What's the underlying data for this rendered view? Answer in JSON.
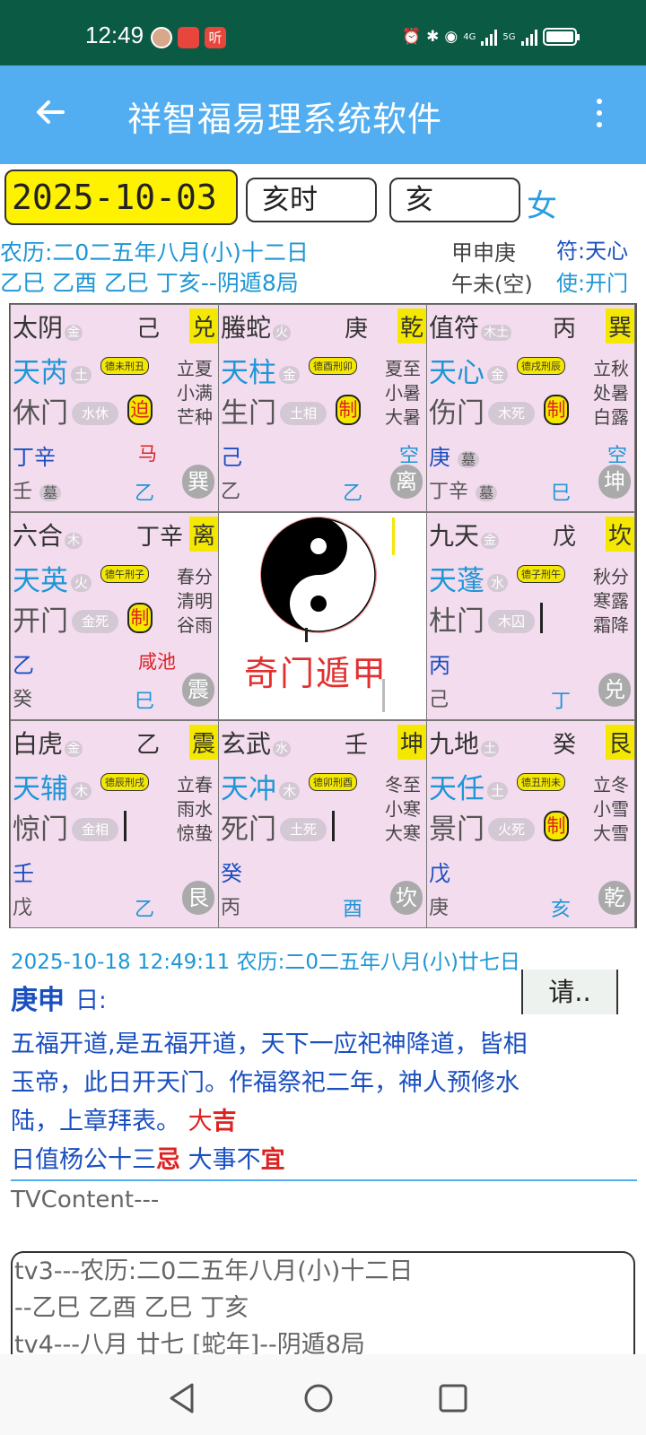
{
  "status_bar": {
    "time": "12:49",
    "app2_label": "听",
    "network": "4G",
    "network2": "5G"
  },
  "toolbar": {
    "title": "祥智福易理系统软件"
  },
  "controls": {
    "date": "2025-10-03",
    "hour": "亥时",
    "branch": "亥",
    "gender": "女"
  },
  "info": {
    "lunar_date": "农历:二0二五年八月(小)十二日",
    "ganzhi_line": "乙巳 乙酉 乙巳 丁亥--阴遁8局",
    "gz_top": "甲申庚",
    "gz_bottom": "午未(空)",
    "fu": "符:天心",
    "shi": "使:开门"
  },
  "grid": {
    "cells": [
      {
        "god": "太阴",
        "god_el": "金",
        "tg": "己",
        "trig": "兑",
        "star": "天芮",
        "star_el": "土",
        "badge": "德未刑丑",
        "terms": [
          "立夏",
          "小满",
          "芒种"
        ],
        "door": "休门",
        "status": "水休",
        "mark": "迫",
        "g1": "丁辛",
        "g1_tomb": "",
        "side": "马",
        "empty": "",
        "g2": "壬",
        "g2_tomb": "墓",
        "stem": "乙",
        "palace": "巽"
      },
      {
        "god": "螣蛇",
        "god_el": "火",
        "tg": "庚",
        "trig": "乾",
        "star": "天柱",
        "star_el": "金",
        "badge": "德酉刑卯",
        "terms": [
          "夏至",
          "小暑",
          "大暑"
        ],
        "door": "生门",
        "status": "土相",
        "mark": "制",
        "g1": "己",
        "g1_tomb": "",
        "side": "",
        "empty": "空",
        "g2": "乙",
        "g2_tomb": "",
        "stem": "乙",
        "palace": "离"
      },
      {
        "god": "值符",
        "god_el": "木土",
        "tg": "丙",
        "trig": "巽",
        "star": "天心",
        "star_el": "金",
        "badge": "德戌刑辰",
        "terms": [
          "立秋",
          "处暑",
          "白露"
        ],
        "door": "伤门",
        "status": "木死",
        "mark": "制",
        "g1": "庚",
        "g1_tomb": "墓",
        "side": "",
        "empty": "空",
        "g2": "丁辛",
        "g2_tomb": "墓",
        "stem": "巳",
        "palace": "坤"
      },
      {
        "god": "六合",
        "god_el": "木",
        "tg": "丁辛",
        "trig": "离",
        "star": "天英",
        "star_el": "火",
        "badge": "德午刑子",
        "terms": [
          "春分",
          "清明",
          "谷雨"
        ],
        "door": "开门",
        "status": "金死",
        "mark": "制",
        "g1": "乙",
        "g1_tomb": "",
        "side": "咸池",
        "empty": "",
        "g2": "癸",
        "g2_tomb": "",
        "stem": "巳",
        "palace": "震"
      },
      {
        "center": true,
        "label": "奇门遁甲"
      },
      {
        "god": "九天",
        "god_el": "金",
        "tg": "戊",
        "trig": "坎",
        "star": "天蓬",
        "star_el": "水",
        "badge": "德子刑午",
        "terms": [
          "秋分",
          "寒露",
          "霜降"
        ],
        "door": "杜门",
        "status": "木囚",
        "mark": "",
        "g1": "丙",
        "g1_tomb": "",
        "side": "",
        "empty": "",
        "g2": "己",
        "g2_tomb": "",
        "stem": "丁",
        "palace": "兑"
      },
      {
        "god": "白虎",
        "god_el": "金",
        "tg": "乙",
        "trig": "震",
        "star": "天辅",
        "star_el": "木",
        "badge": "德辰刑戌",
        "terms": [
          "立春",
          "雨水",
          "惊蛰"
        ],
        "door": "惊门",
        "status": "金相",
        "mark": "",
        "g1": "壬",
        "g1_tomb": "",
        "side": "",
        "empty": "",
        "g2": "戊",
        "g2_tomb": "",
        "stem": "乙",
        "palace": "艮"
      },
      {
        "god": "玄武",
        "god_el": "水",
        "tg": "壬",
        "trig": "坤",
        "star": "天冲",
        "star_el": "木",
        "badge": "德卯刑酉",
        "terms": [
          "冬至",
          "小寒",
          "大寒"
        ],
        "door": "死门",
        "status": "土死",
        "mark": "",
        "g1": "癸",
        "g1_tomb": "",
        "side": "",
        "empty": "",
        "g2": "丙",
        "g2_tomb": "",
        "stem": "酉",
        "palace": "坎"
      },
      {
        "god": "九地",
        "god_el": "土",
        "tg": "癸",
        "trig": "艮",
        "star": "天任",
        "star_el": "土",
        "badge": "德丑刑未",
        "terms": [
          "立冬",
          "小雪",
          "大雪"
        ],
        "door": "景门",
        "status": "火死",
        "mark": "制",
        "g1": "戊",
        "g1_tomb": "",
        "side": "",
        "empty": "",
        "g2": "庚",
        "g2_tomb": "",
        "stem": "亥",
        "palace": "乾"
      }
    ]
  },
  "details": {
    "now_line": "2025-10-18 12:49:11  农历:二0二五年八月(小)廿七日",
    "day_ganzhi": "庚申",
    "day_suffix": "日:",
    "request_label": "请..",
    "desc_text": "五福开道,是五福开道，天下一应祀神降道，皆相玉帝，此日开天门。作福祭祀二年，神人预修水陆，上章拜表。",
    "ji_prefix": "大",
    "ji": "吉",
    "line2_a": "日值杨公十三",
    "ji2": "忌",
    "line2_b": "大事不",
    "yi": "宜",
    "tv_content": "TVContent---",
    "tv3": "tv3---农历:二0二五年八月(小)十二日",
    "tv3b": "--乙巳 乙酉 乙巳 丁亥",
    "tv4": "tv4---八月 廿七 [蛇年]--阴遁8局"
  },
  "colors": {
    "status_bar": "#0a5a44",
    "toolbar": "#52aef0",
    "accent_yellow": "#f5e800",
    "grid_bg": "#f4dcef",
    "blue_text": "#1e96d6",
    "dark_blue": "#1a4fc0",
    "red": "#d22222"
  }
}
